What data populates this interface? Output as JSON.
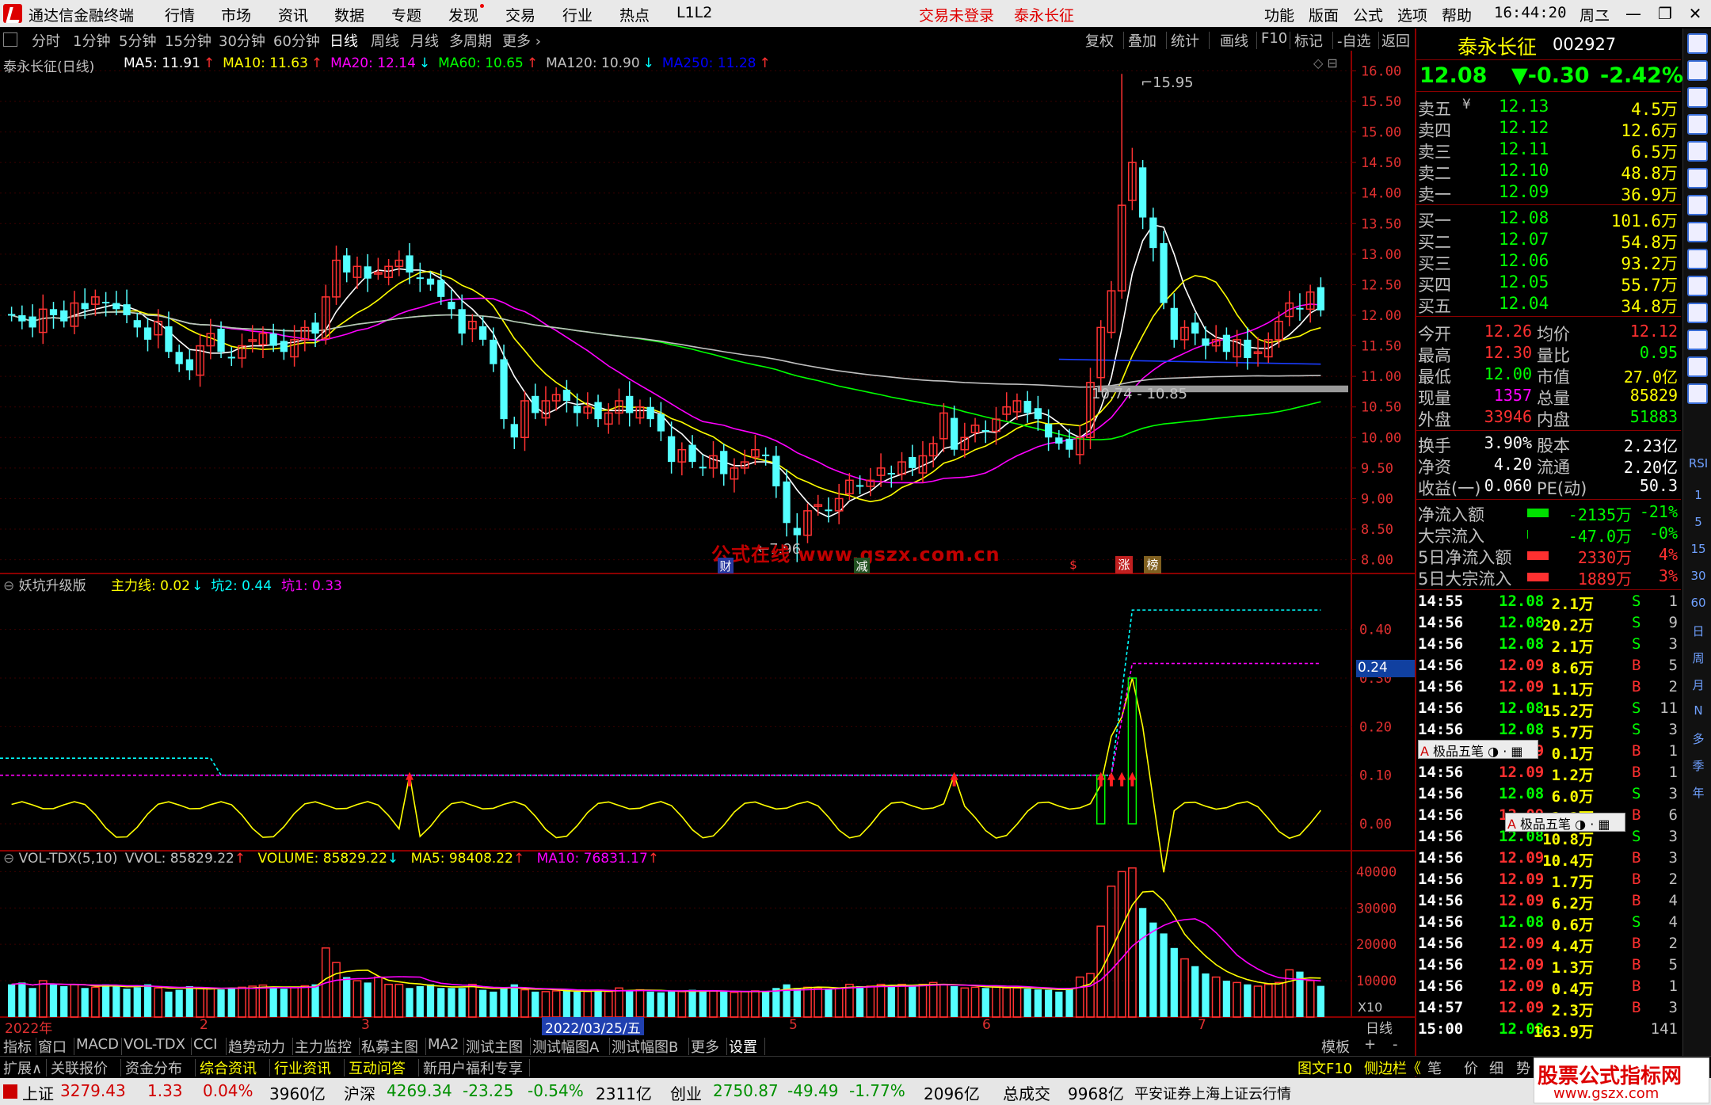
{
  "titlebar": {
    "app_title": "通达信金融终端",
    "menu": [
      "行情",
      "市场",
      "资讯",
      "数据",
      "专题",
      "发现",
      "交易",
      "行业",
      "热点",
      "L1L2"
    ],
    "trade_status": "交易未登录",
    "stock_name": "泰永长征",
    "right_menu": [
      "功能",
      "版面",
      "公式",
      "选项",
      "帮助"
    ],
    "time": "16:44:20",
    "weekday": "周二"
  },
  "periods": [
    "分时",
    "1分钟",
    "5分钟",
    "15分钟",
    "30分钟",
    "60分钟",
    "日线",
    "周线",
    "月线",
    "多周期",
    "更多"
  ],
  "selected_period": "日线",
  "toolbar_right": [
    "复权",
    "叠加",
    "统计",
    "画线",
    "F10",
    "标记",
    "-自选",
    "返回"
  ],
  "main_panel": {
    "legend_name": "泰永长征(日线)",
    "ma": [
      {
        "label": "MA5: 11.91",
        "color": "#ffffff"
      },
      {
        "label": "MA10: 11.63",
        "color": "#ffff00"
      },
      {
        "label": "MA20: 12.14",
        "color": "#ff00ff"
      },
      {
        "label": "MA60: 10.65",
        "color": "#00ff00"
      },
      {
        "label": "MA120: 10.90",
        "color": "#c0c0c0"
      },
      {
        "label": "MA250: 11.28",
        "color": "#0000ff"
      }
    ],
    "ma_arrows": [
      "↑",
      "↑",
      "↓",
      "↑",
      "↓",
      "↑"
    ],
    "y_ticks": [
      "16.00",
      "15.50",
      "15.00",
      "14.50",
      "14.00",
      "13.50",
      "13.00",
      "12.50",
      "12.00",
      "11.50",
      "11.00",
      "10.50",
      "10.00",
      "9.50",
      "9.00",
      "8.50",
      "8.00"
    ],
    "high_label": "15.95",
    "low_label": "7.96",
    "range_label": "10.74 - 10.85",
    "watermark": "公式在线  www.gszx.com.cn",
    "markers": [
      "财",
      "减",
      "$",
      "涨",
      "榜"
    ]
  },
  "indicator_panel": {
    "name": "妖坑升级版",
    "lines": [
      {
        "label": "主力线: 0.02",
        "color": "#ffff00",
        "arrow": "↓"
      },
      {
        "label": "坑2: 0.44",
        "color": "#00ffff",
        "arrow": ""
      },
      {
        "label": "坑1: 0.33",
        "color": "#ff00ff",
        "arrow": ""
      }
    ],
    "y_ticks": [
      "0.40",
      "0.30",
      "0.20",
      "0.10",
      "0.00"
    ],
    "current_value": "0.24"
  },
  "volume_panel": {
    "name": "VOL-TDX(5,10)",
    "vvol": "VVOL: 85829.22",
    "volume": "VOLUME: 85829.22",
    "ma5": "MA5: 98408.22",
    "ma10": "MA10: 76831.17",
    "y_ticks": [
      "40000",
      "30000",
      "20000",
      "10000"
    ],
    "unit": "X10"
  },
  "x_axis": {
    "labels": [
      "2022年",
      "2",
      "3",
      "2022/03/25/五",
      "5",
      "6",
      "7"
    ],
    "right_label": "日线"
  },
  "quote": {
    "name": "泰永长征",
    "code": "002927",
    "price": "12.08",
    "change": "▼-0.30",
    "change_pct": "-2.42%",
    "asks": [
      {
        "label": "卖五",
        "price": "12.13",
        "vol": "4.5万",
        "mark": "¥"
      },
      {
        "label": "卖四",
        "price": "12.12",
        "vol": "12.6万"
      },
      {
        "label": "卖三",
        "price": "12.11",
        "vol": "6.5万"
      },
      {
        "label": "卖二",
        "price": "12.10",
        "vol": "48.8万"
      },
      {
        "label": "卖一",
        "price": "12.09",
        "vol": "36.9万"
      }
    ],
    "bids": [
      {
        "label": "买一",
        "price": "12.08",
        "vol": "101.6万"
      },
      {
        "label": "买二",
        "price": "12.07",
        "vol": "54.8万"
      },
      {
        "label": "买三",
        "price": "12.06",
        "vol": "93.2万"
      },
      {
        "label": "买四",
        "price": "12.05",
        "vol": "55.7万"
      },
      {
        "label": "买五",
        "price": "12.04",
        "vol": "34.8万"
      }
    ],
    "stats": [
      {
        "l1": "今开",
        "v1": "12.26",
        "l2": "均价",
        "v2": "12.12"
      },
      {
        "l1": "最高",
        "v1": "12.30",
        "l2": "量比",
        "v2": "0.95"
      },
      {
        "l1": "最低",
        "v1": "12.00",
        "l2": "市值",
        "v2": "27.0亿"
      },
      {
        "l1": "现量",
        "v1": "1357",
        "l2": "总量",
        "v2": "85829"
      },
      {
        "l1": "外盘",
        "v1": "33946",
        "l2": "内盘",
        "v2": "51883"
      }
    ],
    "stats2": [
      {
        "l1": "换手",
        "v1": "3.90%",
        "l2": "股本",
        "v2": "2.23亿"
      },
      {
        "l1": "净资",
        "v1": "4.20",
        "l2": "流通",
        "v2": "2.20亿"
      },
      {
        "l1": "收益(一)",
        "v1": "0.060",
        "l2": "PE(动)",
        "v2": "50.3"
      }
    ],
    "flows": [
      {
        "label": "净流入额",
        "value": "-2135万",
        "pct": "-21%",
        "bar": "#00e000",
        "barw": 0.85
      },
      {
        "label": "大宗流入",
        "value": "-47.0万",
        "pct": "-0%",
        "bar": "#00e000",
        "barw": 0.03
      },
      {
        "label": "5日净流入额",
        "value": "2330万",
        "pct": "4%",
        "bar": "#ff3030",
        "barw": 0.85
      },
      {
        "label": "5日大宗流入",
        "value": "1889万",
        "pct": "3%",
        "bar": "#ff3030",
        "barw": 0.85
      }
    ],
    "ticks": [
      {
        "t": "14:55",
        "p": "12.08",
        "v": "2.1万",
        "s": "S",
        "n": "1"
      },
      {
        "t": "14:56",
        "p": "12.08",
        "v": "20.2万",
        "s": "S",
        "n": "9"
      },
      {
        "t": "14:56",
        "p": "12.08",
        "v": "2.1万",
        "s": "S",
        "n": "3"
      },
      {
        "t": "14:56",
        "p": "12.09",
        "v": "8.6万",
        "s": "B",
        "n": "5"
      },
      {
        "t": "14:56",
        "p": "12.09",
        "v": "1.1万",
        "s": "B",
        "n": "2"
      },
      {
        "t": "14:56",
        "p": "12.08",
        "v": "15.2万",
        "s": "S",
        "n": "11"
      },
      {
        "t": "14:56",
        "p": "12.08",
        "v": "5.7万",
        "s": "S",
        "n": "3"
      },
      {
        "t": "14:56",
        "p": "12.09",
        "v": "0.1万",
        "s": "B",
        "n": "1"
      },
      {
        "t": "14:56",
        "p": "12.09",
        "v": "1.2万",
        "s": "B",
        "n": "1"
      },
      {
        "t": "14:56",
        "p": "12.08",
        "v": "6.0万",
        "s": "S",
        "n": "3"
      },
      {
        "t": "14:56",
        "p": "12.09",
        "v": "2.2万",
        "s": "B",
        "n": "6"
      },
      {
        "t": "14:56",
        "p": "12.08",
        "v": "10.8万",
        "s": "S",
        "n": "3"
      },
      {
        "t": "14:56",
        "p": "12.09",
        "v": "10.4万",
        "s": "B",
        "n": "3"
      },
      {
        "t": "14:56",
        "p": "12.09",
        "v": "1.7万",
        "s": "B",
        "n": "2"
      },
      {
        "t": "14:56",
        "p": "12.09",
        "v": "6.2万",
        "s": "B",
        "n": "4"
      },
      {
        "t": "14:56",
        "p": "12.08",
        "v": "0.6万",
        "s": "S",
        "n": "4"
      },
      {
        "t": "14:56",
        "p": "12.09",
        "v": "4.4万",
        "s": "B",
        "n": "2"
      },
      {
        "t": "14:56",
        "p": "12.09",
        "v": "1.3万",
        "s": "B",
        "n": "5"
      },
      {
        "t": "14:56",
        "p": "12.09",
        "v": "0.4万",
        "s": "B",
        "n": "1"
      },
      {
        "t": "14:57",
        "p": "12.09",
        "v": "2.3万",
        "s": "B",
        "n": "3"
      },
      {
        "t": "15:00",
        "p": "12.08",
        "v": "163.9万",
        "s": "",
        "n": "141"
      }
    ],
    "ime_popup": "极品五笔"
  },
  "side_icons_text": [
    "RSI",
    "1",
    "5",
    "15",
    "30",
    "60",
    "日",
    "周",
    "月",
    "N",
    "多",
    "季",
    "年"
  ],
  "tabs1": [
    "指标",
    "窗口",
    "MACD",
    "VOL-TDX",
    "CCI",
    "趋势动力",
    "主力监控",
    "私募主图",
    "MA2",
    "测试主图",
    "测试幅图A",
    "测试幅图B",
    "更多",
    "设置"
  ],
  "tabs1_right": [
    "模板",
    "+",
    "-"
  ],
  "tabs2": [
    "扩展∧",
    "关联报价",
    "资金分布",
    "综合资讯",
    "行业资讯",
    "互动问答",
    "新用户福利专享"
  ],
  "tabs2_right": [
    "图文F10",
    "侧边栏《",
    "笔",
    "价",
    "细",
    "势"
  ],
  "status": {
    "sh_label": "上证",
    "sh_val": "3279.43",
    "sh_chg": "1.33",
    "sh_pct": "0.04%",
    "sh_amt": "3960亿",
    "hs_label": "沪深",
    "hs_val": "4269.34",
    "hs_chg": "-23.25",
    "hs_pct": "-0.54%",
    "hs_amt": "2311亿",
    "cy_label": "创业",
    "cy_val": "2750.87",
    "cy_chg": "-49.49",
    "cy_pct": "-1.77%",
    "cy_amt": "2096亿",
    "total_label": "总成交",
    "total_val": "9968亿",
    "broker": "平安证券上海上证云行情",
    "brand": "股票公式指标网",
    "brand_url": "www.gszx.com"
  },
  "chart_data": {
    "type": "candlestick",
    "price_range": [
      7.8,
      16.2
    ],
    "notes": "approximate daily OHLC read from chart, Jan–Jul 2022",
    "close": [
      12.0,
      11.9,
      11.8,
      12.1,
      12.0,
      11.9,
      12.2,
      12.1,
      12.3,
      12.2,
      12.1,
      12.0,
      11.8,
      11.6,
      11.9,
      11.4,
      11.2,
      11.1,
      11.5,
      11.7,
      11.4,
      11.3,
      11.5,
      11.6,
      11.7,
      11.5,
      11.4,
      11.6,
      11.8,
      11.7,
      12.3,
      12.9,
      12.7,
      12.8,
      12.6,
      12.7,
      12.8,
      12.9,
      12.7,
      12.6,
      12.5,
      12.3,
      12.1,
      11.7,
      11.9,
      11.6,
      11.2,
      10.3,
      10.0,
      10.6,
      10.4,
      10.6,
      10.7,
      10.6,
      10.4,
      10.5,
      10.3,
      10.4,
      10.6,
      10.4,
      10.5,
      10.3,
      10.1,
      9.6,
      9.8,
      9.6,
      9.5,
      9.7,
      9.4,
      9.5,
      9.6,
      9.8,
      9.7,
      9.2,
      8.6,
      8.4,
      8.8,
      8.9,
      8.8,
      9.0,
      9.3,
      9.2,
      9.3,
      9.5,
      9.4,
      9.6,
      9.5,
      9.7,
      9.9,
      10.4,
      9.8,
      10.0,
      10.2,
      10.1,
      10.3,
      10.5,
      10.6,
      10.4,
      10.3,
      10.0,
      9.9,
      9.8,
      10.0,
      10.9,
      11.8,
      12.4,
      13.8,
      14.5,
      13.6,
      13.1,
      12.2,
      11.6,
      11.8,
      11.7,
      11.5,
      11.6,
      11.4,
      11.6,
      11.3,
      11.4,
      11.6,
      11.9,
      12.2,
      12.1,
      12.38,
      12.08
    ],
    "volume": [
      9000,
      9500,
      8000,
      10000,
      9000,
      8500,
      9000,
      8000,
      8200,
      9000,
      8700,
      7800,
      8200,
      9000,
      8000,
      7000,
      7500,
      8500,
      8000,
      7800,
      7600,
      8000,
      8200,
      8500,
      8800,
      8000,
      7800,
      8200,
      8600,
      9000,
      19000,
      15000,
      11000,
      10000,
      9500,
      11000,
      9000,
      9000,
      8000,
      8500,
      9000,
      8000,
      8000,
      8000,
      9000,
      7500,
      7000,
      8000,
      9000,
      7500,
      7000,
      7000,
      7200,
      7500,
      7000,
      7000,
      7200,
      7000,
      8000,
      7400,
      7500,
      7000,
      6800,
      7200,
      7000,
      7500,
      7000,
      7200,
      7000,
      6800,
      7000,
      7200,
      7000,
      8000,
      9000,
      8000,
      8200,
      8000,
      7800,
      8000,
      9000,
      8500,
      8500,
      9000,
      8800,
      9000,
      8500,
      9000,
      9500,
      9000,
      8500,
      8000,
      8200,
      8000,
      8500,
      8000,
      8000,
      7800,
      7600,
      7500,
      7000,
      8000,
      11000,
      12000,
      25000,
      36000,
      40000,
      41000,
      30000,
      26000,
      23000,
      19000,
      16000,
      14000,
      12000,
      11000,
      10000,
      9500,
      9000,
      8500,
      9000,
      9500,
      13000,
      12500,
      10000,
      8582
    ]
  }
}
